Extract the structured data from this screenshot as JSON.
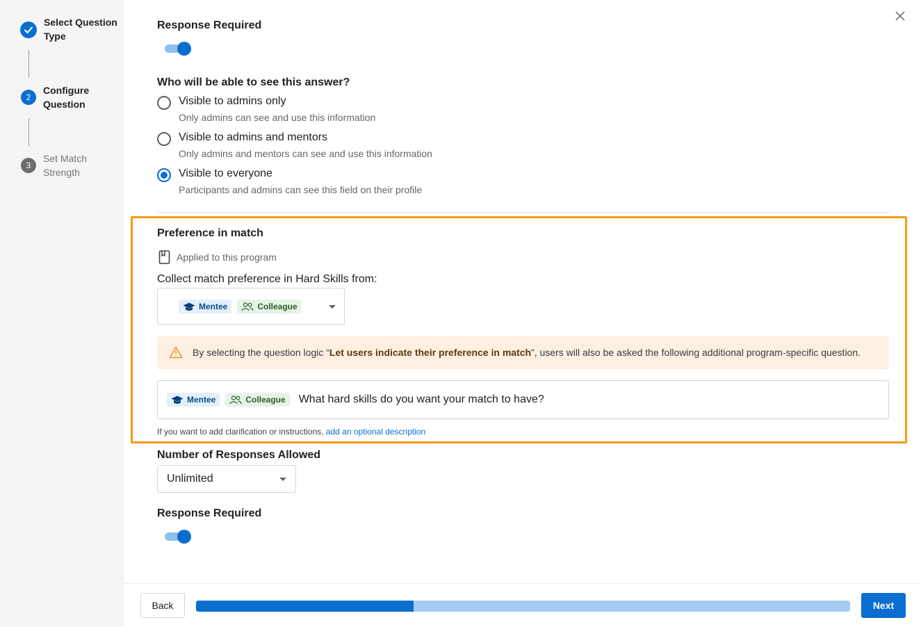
{
  "sidebar": {
    "steps": [
      {
        "number": "",
        "label": "Select Question Type",
        "state": "done"
      },
      {
        "number": "2",
        "label": "Configure Question",
        "state": "active"
      },
      {
        "number": "3",
        "label": "Set Match Strength",
        "state": "pending"
      }
    ]
  },
  "top": {
    "response_required_label": "Response Required",
    "response_required_on": true
  },
  "visibility": {
    "question": "Who will be able to see this answer?",
    "options": [
      {
        "title": "Visible to admins only",
        "description": "Only admins can see and use this information",
        "checked": false
      },
      {
        "title": "Visible to admins and mentors",
        "description": "Only admins and mentors can see and use this information",
        "checked": false
      },
      {
        "title": "Visible to everyone",
        "description": "Participants and admins can see this field on their profile",
        "checked": true
      }
    ]
  },
  "preference": {
    "title": "Preference in match",
    "applied_text": "Applied to this program",
    "collect_label": "Collect match preference in Hard Skills from:",
    "chips": {
      "mentee": "Mentee",
      "colleague": "Colleague"
    },
    "warning_prefix": "By selecting the question logic “",
    "warning_bold": "Let users indicate their preference in match",
    "warning_suffix": "”, users will also be asked the following additional program-specific question.",
    "question_text": "What hard skills do you want your match to have?",
    "help_prefix": "If you want to add clarification or instructions, ",
    "help_link": "add an optional description"
  },
  "responses": {
    "label": "Number of Responses Allowed",
    "value": "Unlimited"
  },
  "bottom": {
    "response_required_label": "Response Required",
    "response_required_on": true
  },
  "footer": {
    "back_label": "Back",
    "next_label": "Next",
    "progress_fraction": 0.333
  },
  "colors": {
    "primary": "#0a6ed1",
    "highlight": "#f39c12",
    "warning_bg": "#fdf0e3"
  }
}
